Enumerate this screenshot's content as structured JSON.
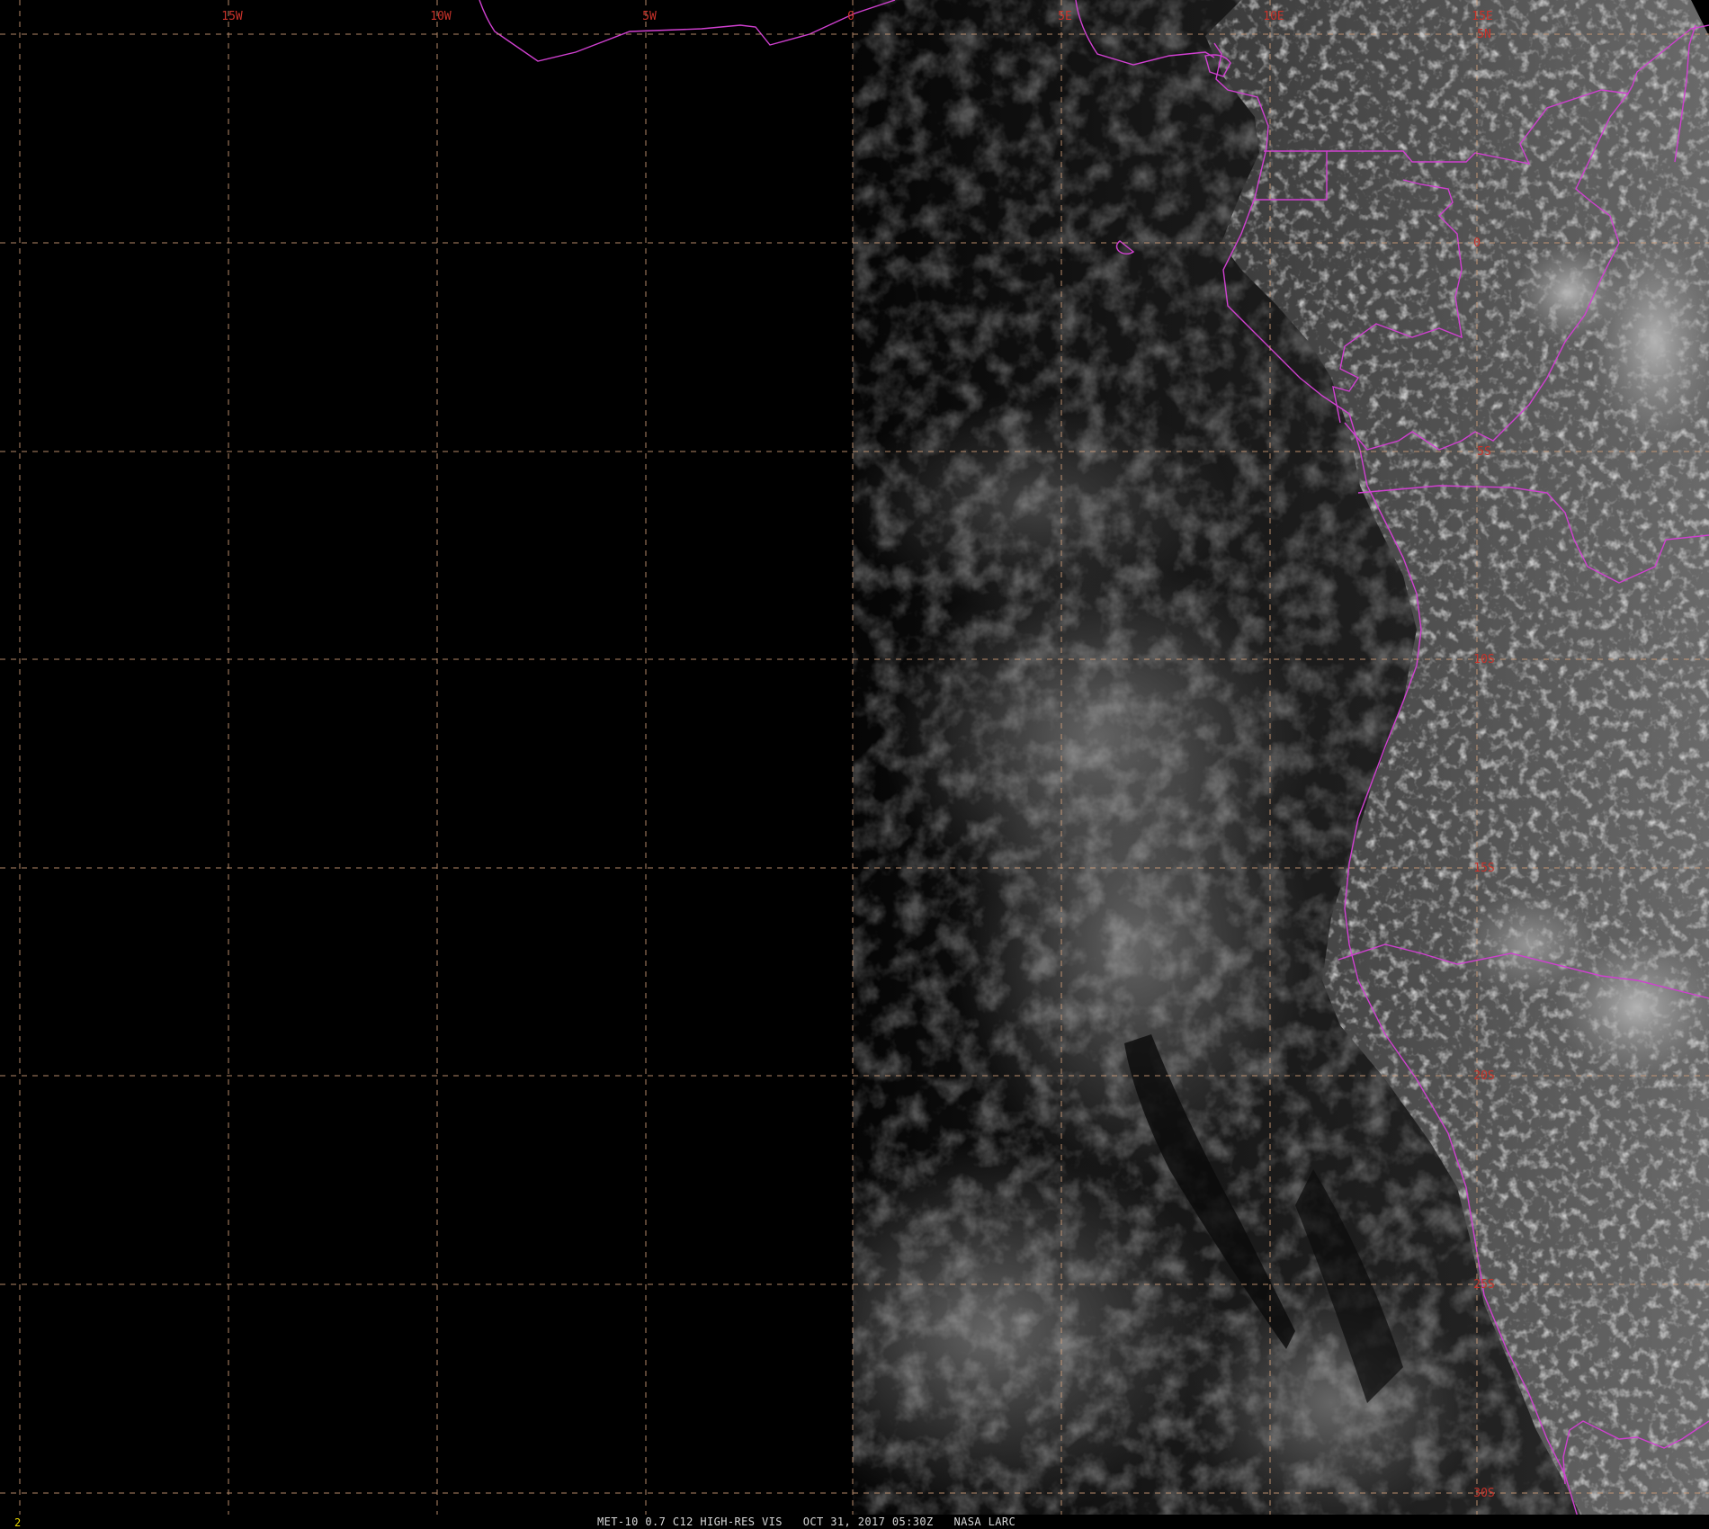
{
  "caption": {
    "sensor": "MET-10 0.7 C12 HIGH-RES VIS",
    "datetime": "OCT 31, 2017 05:30Z",
    "source": "NASA LARC"
  },
  "frame_number": "2",
  "colors": {
    "background": "#000000",
    "grid": "#d4a07a",
    "borders": "#d040d0",
    "grid_labels": "#c8322a",
    "frame_number": "#e8d800",
    "caption_text": "#d8d8d8"
  },
  "longitude_labels": [
    "15W",
    "10W",
    "5W",
    "0",
    "5E",
    "10E",
    "15E"
  ],
  "latitude_labels": [
    "5N",
    "0",
    "5S",
    "10S",
    "15S",
    "20S",
    "25S",
    "30S"
  ],
  "icons": {
    "imagery": "satellite-visible-imagery",
    "borders": "country-border-lines",
    "grid": "lat-lon-graticule"
  }
}
